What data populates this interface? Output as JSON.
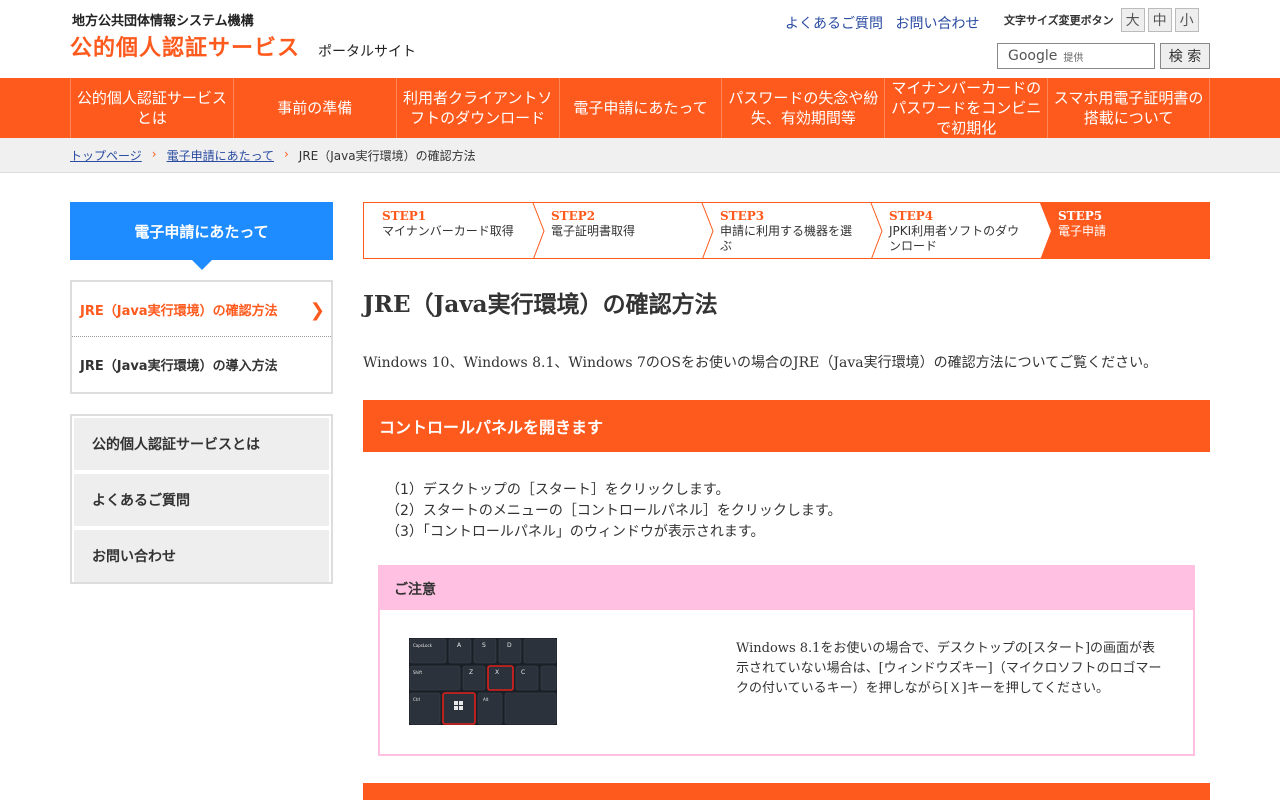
{
  "header": {
    "org": "地方公共団体情報システム機構",
    "brand": "公的個人認証サービス",
    "brand_sub": "ポータルサイト",
    "links": [
      "よくあるご質問",
      "お問い合わせ"
    ],
    "font_size_label": "文字サイズ変更ボタン",
    "font_sizes": [
      "大",
      "中",
      "小"
    ],
    "search_provider": "Google",
    "search_provided": "提供",
    "search_button": "検 索"
  },
  "nav": [
    "公的個人認証サービスとは",
    "事前の準備",
    "利用者クライアントソフトのダウンロード",
    "電子申請にあたって",
    "パスワードの失念や紛失、有効期間等",
    "マイナンバーカードのパスワードをコンビニで初期化",
    "スマホ用電子証明書の搭載について"
  ],
  "breadcrumb": {
    "items": [
      "トップページ",
      "電子申請にあたって"
    ],
    "current": "JRE（Java実行環境）の確認方法"
  },
  "sidebar": {
    "heading": "電子申請にあたって",
    "items": [
      "JRE（Java実行環境）の確認方法",
      "JRE（Java実行環境）の導入方法"
    ],
    "menu": [
      "公的個人認証サービスとは",
      "よくあるご質問",
      "お問い合わせ"
    ]
  },
  "steps": [
    {
      "num": "STEP1",
      "label": "マイナンバーカード取得"
    },
    {
      "num": "STEP2",
      "label": "電子証明書取得"
    },
    {
      "num": "STEP3",
      "label": "申請に利用する機器を選ぶ"
    },
    {
      "num": "STEP4",
      "label": "JPKI利用者ソフトのダウンロード"
    },
    {
      "num": "STEP5",
      "label": "電子申請"
    }
  ],
  "main": {
    "title": "JRE（Java実行環境）の確認方法",
    "intro": "Windows 10、Windows 8.1、Windows 7のOSをお使いの場合のJRE（Java実行環境）の確認方法についてご覧ください。",
    "section_title": "コントロールパネルを開きます",
    "instructions": [
      "（1）デスクトップの［スタート］をクリックします。",
      "（2）スタートのメニューの［コントロールパネル］をクリックします。",
      "（3）「コントロールパネル」のウィンドウが表示されます。"
    ],
    "note_title": "ご注意",
    "note_text": "Windows 8.1をお使いの場合で、デスクトップの[スタート]の画面が表示されていない場合は、[ウィンドウズキー]（マイクロソフトのロゴマークの付いているキー）を押しながら[Ｘ]キーを押してください。"
  },
  "keyboard": {
    "row1": [
      "A",
      "S",
      "D"
    ],
    "row2": [
      "Z",
      "X",
      "C"
    ],
    "capslock": "CapsLock",
    "shift": "Shift",
    "ctrl": "Ctrl",
    "alt": "Alt"
  },
  "colors": {
    "brand": "#fe5a1d",
    "link": "#2a4ca1",
    "sidebar_head": "#1e8cff",
    "note": "#ffc0e1"
  }
}
